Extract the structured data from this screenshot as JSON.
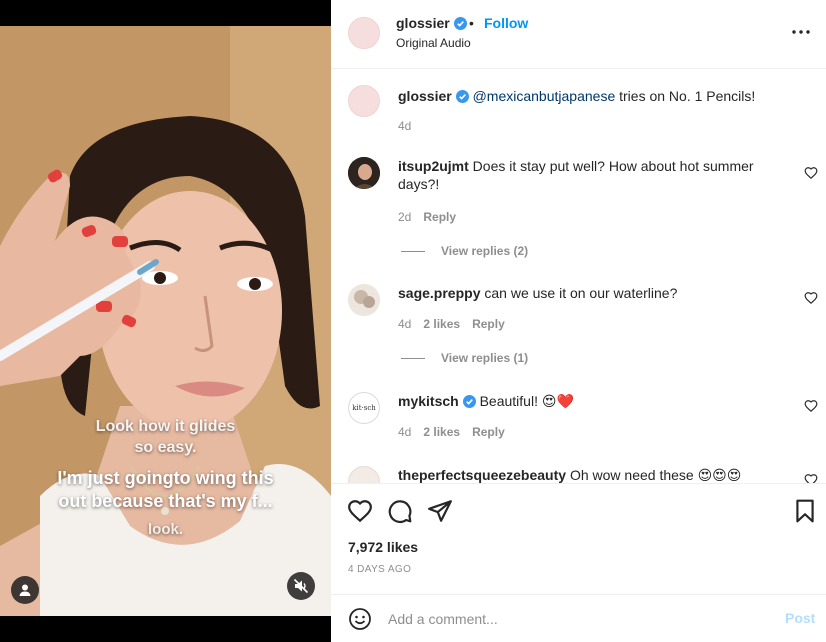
{
  "video": {
    "caption_line1": [
      "Look how it glides",
      "so easy."
    ],
    "caption_line2": [
      "I'm just goingto wing this",
      "out because that's my f..."
    ],
    "caption_line3": "look."
  },
  "post": {
    "username": "glossier",
    "separator": "•",
    "follow_label": "Follow",
    "audio": "Original Audio"
  },
  "caption_comment": {
    "username": "glossier",
    "mention": "@mexicanbutjapanese",
    "text": " tries on No. 1 Pencils!",
    "time": "4d"
  },
  "comments": [
    {
      "username": "itsup2ujmt",
      "text": "Does it stay put well? How about hot summer days?!",
      "time": "2d",
      "likes": "",
      "reply": "Reply",
      "view_replies": "View replies (2)"
    },
    {
      "username": "sage.preppy",
      "text": "can we use it on our waterline?",
      "time": "4d",
      "likes": "2 likes",
      "reply": "Reply",
      "view_replies": "View replies (1)"
    },
    {
      "username": "mykitsch",
      "text": "Beautiful! 😍❤️",
      "time": "4d",
      "likes": "2 likes",
      "reply": "Reply",
      "avatar_text": "kit·sch"
    },
    {
      "username": "theperfectsqueezebeauty",
      "text": "Oh wow need these 😍😍😍",
      "time": "",
      "likes": "",
      "reply": ""
    }
  ],
  "stats": {
    "likes": "7,972 likes",
    "date": "4 DAYS AGO"
  },
  "composer": {
    "placeholder": "Add a comment...",
    "post_label": "Post"
  },
  "colors": {
    "accent": "#0095f6",
    "verified": "#3897f0",
    "muted": "#8e8e8e",
    "post_disabled": "#b2dffc"
  }
}
